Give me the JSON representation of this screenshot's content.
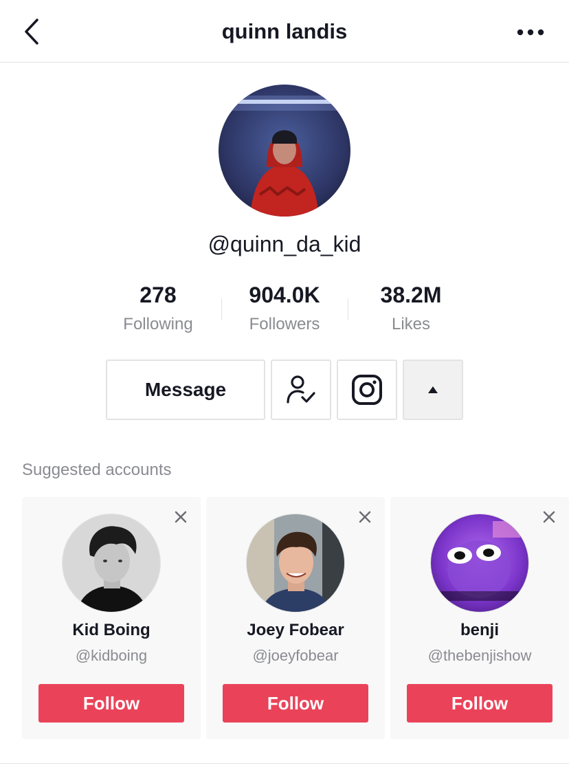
{
  "header": {
    "title": "quinn landis",
    "back_icon": "chevron-left-icon",
    "more_icon": "more-horizontal-icon"
  },
  "profile": {
    "handle": "@quinn_da_kid",
    "stats": [
      {
        "value": "278",
        "label": "Following"
      },
      {
        "value": "904.0K",
        "label": "Followers"
      },
      {
        "value": "38.2M",
        "label": "Likes"
      }
    ]
  },
  "actions": {
    "message_label": "Message",
    "friend_icon": "user-check-icon",
    "instagram_icon": "instagram-icon",
    "toggle_icon": "triangle-up-icon"
  },
  "suggested": {
    "title": "Suggested accounts",
    "accounts": [
      {
        "name": "Kid Boing",
        "handle": "@kidboing",
        "follow_label": "Follow"
      },
      {
        "name": "Joey Fobear",
        "handle": "@joeyfobear",
        "follow_label": "Follow"
      },
      {
        "name": "benji",
        "handle": "@thebenjishow",
        "follow_label": "Follow"
      }
    ]
  },
  "colors": {
    "follow_button": "#ea4359",
    "text_primary": "#161823",
    "text_secondary": "#8a8b91",
    "border": "#e3e3e4"
  }
}
